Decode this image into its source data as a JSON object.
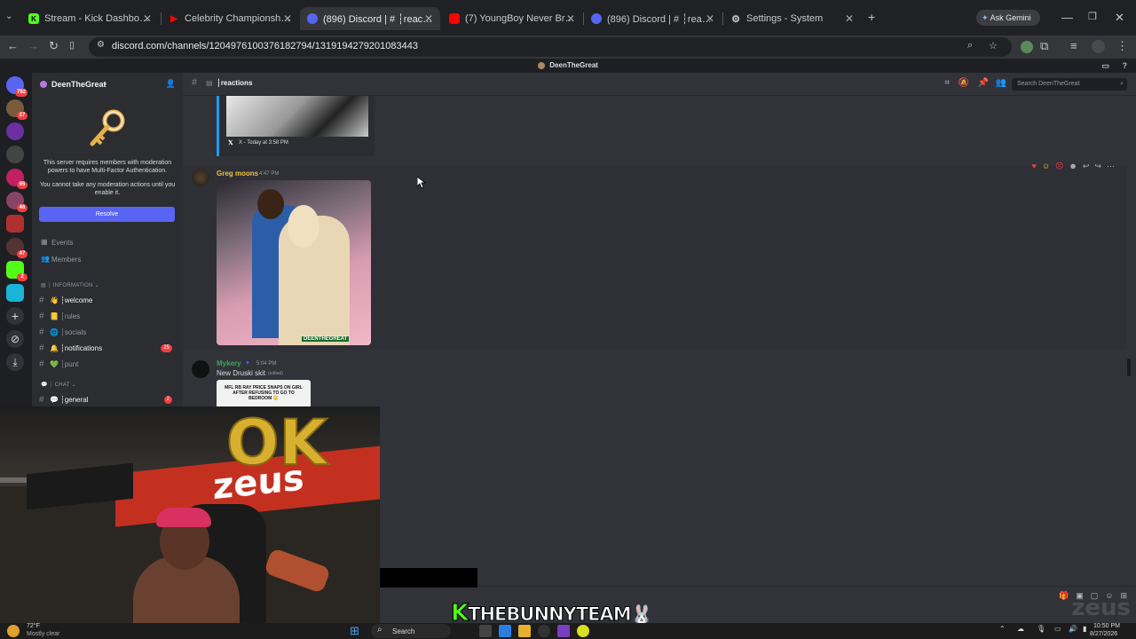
{
  "browser": {
    "tabs": [
      {
        "title": "Stream - Kick Dashboard",
        "icon": "kick-icon",
        "color": "#53fc18"
      },
      {
        "title": "Celebrity Championship Box",
        "icon": "play-icon",
        "color": "#ff0000"
      },
      {
        "title": "(896) Discord | # ┆reactions",
        "icon": "discord-icon",
        "color": "#5865f2"
      },
      {
        "title": "(7) YoungBoy Never Broke Aga",
        "icon": "youtube-icon",
        "color": "#ff0000"
      },
      {
        "title": "(896) Discord | # ┆reactions",
        "icon": "discord-icon",
        "color": "#5865f2"
      },
      {
        "title": "Settings - System",
        "icon": "gear-icon",
        "color": "#9aa0a6"
      }
    ],
    "ask_gemini": "Ask Gemini",
    "url": "discord.com/channels/1204976100376182794/1319194279201083443"
  },
  "discord": {
    "window_title": "DeenTheGreat",
    "server_name": "DeenTheGreat",
    "rail_badges": [
      "792",
      "27",
      "65",
      "46",
      "47",
      "2"
    ],
    "mfa_notice": "This server requires members with moderation powers to have Multi-Factor Authentication.",
    "mfa_sub": "You cannot take any moderation actions until you enable it.",
    "resolve_label": "Resolve",
    "events_label": "Events",
    "members_label": "Members",
    "category_info": "┆ INFORMATION",
    "category_chat": "┆ CHAT",
    "channels": [
      {
        "emoji": "👋",
        "name": "┆welcome",
        "bright": true
      },
      {
        "emoji": "📒",
        "name": "┆rules",
        "bright": false
      },
      {
        "emoji": "🌐",
        "name": "┆socials",
        "bright": false
      },
      {
        "emoji": "🔔",
        "name": "┆notifications",
        "bright": true,
        "count": "25"
      },
      {
        "emoji": "💚",
        "name": "┆punt",
        "bright": false
      }
    ],
    "chat_channel": {
      "emoji": "💬",
      "name": "┆general",
      "count": "2"
    },
    "channel_header": "┆reactions",
    "search_placeholder": "Search DeenTheGreat",
    "embed_footer": "X - Today at 3:58 PM",
    "messages": [
      {
        "author": "Greg moons",
        "time": "4:47 PM",
        "author_color": "#f0c040",
        "image_watermark": "DEENTHEGREAT"
      },
      {
        "author": "Mykery",
        "time": "5:04 PM",
        "author_color": "#3ba55c",
        "text": "New Druski skit",
        "edited": "(edited)",
        "image_caption": "MFL RB RAY PRICE SNAPS ON GIRL AFTER REFUSING TO GO TO BEDROOM 😳"
      }
    ]
  },
  "overlay": {
    "brand": "THEBUNNYTEAM",
    "brand_k": "K",
    "webcam_balloon": "OK",
    "banner": "zeus",
    "watermark": "zeus"
  },
  "taskbar": {
    "weather_temp": "72°F",
    "weather_desc": "Mostly clear",
    "search_label": "Search",
    "time": "10:50 PM",
    "date": "8/27/2026"
  }
}
